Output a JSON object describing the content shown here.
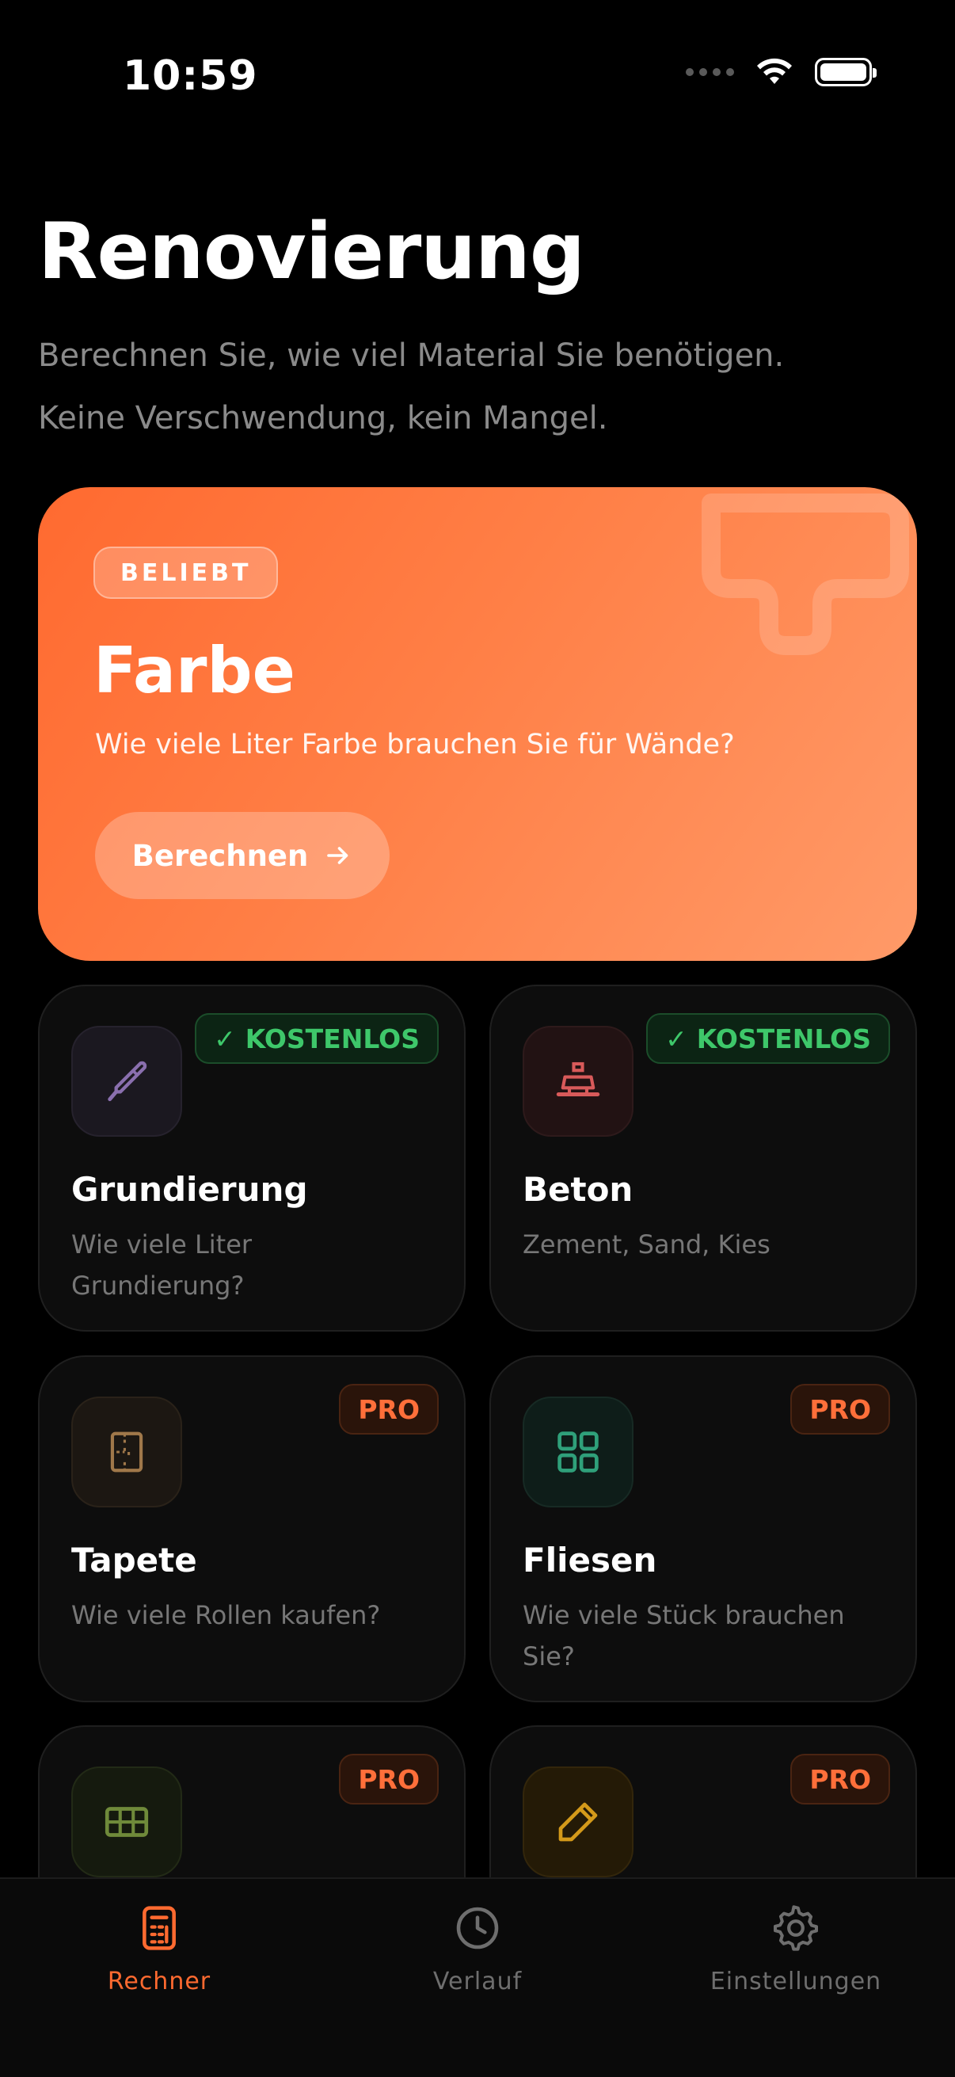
{
  "status_bar": {
    "time": "10:59"
  },
  "header": {
    "title": "Renovierung",
    "subtitle_line1": "Berechnen Sie, wie viel Material Sie benötigen.",
    "subtitle_line2": "Keine Verschwendung, kein Mangel."
  },
  "hero": {
    "badge": "BELIEBT",
    "title": "Farbe",
    "description": "Wie viele Liter Farbe brauchen Sie für Wände?",
    "button_label": "Berechnen",
    "icon": "paint-roller-icon",
    "color_start": "#ff6a30",
    "color_end": "#ff9a68"
  },
  "cards": [
    {
      "title": "Grundierung",
      "description": "Wie viele Liter Grundierung?",
      "badge": "KOSTENLOS",
      "badge_type": "free",
      "icon": "brush-icon",
      "icon_color": "#8a6fae"
    },
    {
      "title": "Beton",
      "description": "Zement, Sand, Kies",
      "badge": "KOSTENLOS",
      "badge_type": "free",
      "icon": "concrete-mixer-icon",
      "icon_color": "#d85a5a"
    },
    {
      "title": "Tapete",
      "description": "Wie viele Rollen kaufen?",
      "badge": "PRO",
      "badge_type": "pro",
      "icon": "wallpaper-icon",
      "icon_color": "#a0784a"
    },
    {
      "title": "Fliesen",
      "description": "Wie viele Stück brauchen Sie?",
      "badge": "PRO",
      "badge_type": "pro",
      "icon": "tiles-icon",
      "icon_color": "#2fa07a"
    },
    {
      "title": "",
      "description": "",
      "badge": "PRO",
      "badge_type": "pro",
      "icon": "grid-icon",
      "icon_color": "#6f8a3a"
    },
    {
      "title": "",
      "description": "",
      "badge": "PRO",
      "badge_type": "pro",
      "icon": "pencil-icon",
      "icon_color": "#d49a1a"
    }
  ],
  "tab_bar": {
    "tabs": [
      {
        "label": "Rechner",
        "icon": "calculator-icon",
        "active": true
      },
      {
        "label": "Verlauf",
        "icon": "clock-icon",
        "active": false
      },
      {
        "label": "Einstellungen",
        "icon": "gear-icon",
        "active": false
      }
    ],
    "active_color": "#ff6a30"
  }
}
